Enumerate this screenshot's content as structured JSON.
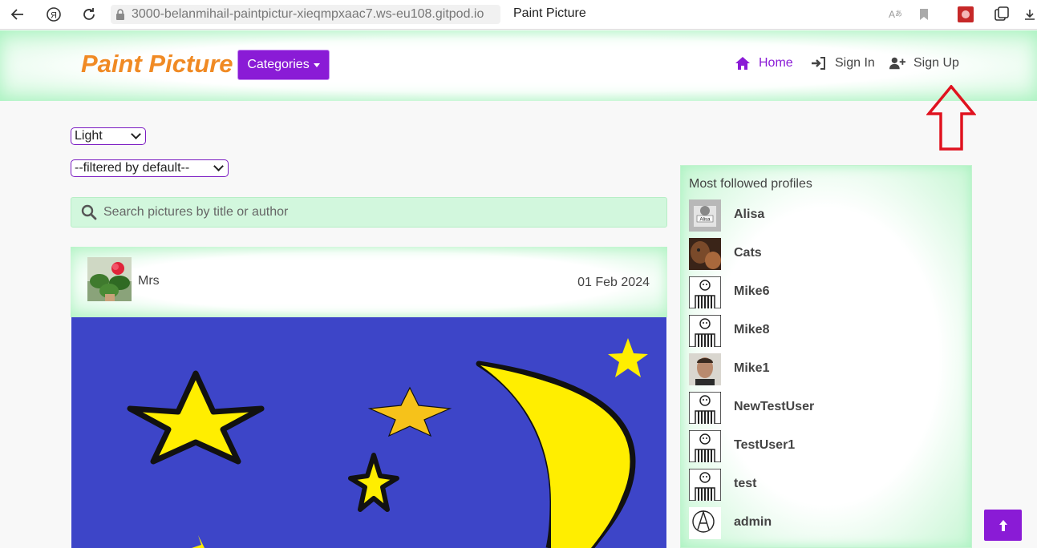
{
  "browser": {
    "url": "3000-belanmihail-paintpictur-xieqmpxaac7.ws-eu108.gitpod.io",
    "tab_title": "Paint Picture"
  },
  "header": {
    "brand": "Paint Picture",
    "categories_label": "Categories",
    "nav": [
      {
        "label": "Home",
        "icon": "home-icon"
      },
      {
        "label": "Sign In",
        "icon": "sign-in-icon"
      },
      {
        "label": "Sign Up",
        "icon": "user-plus-icon"
      }
    ]
  },
  "controls": {
    "theme_select": "Light",
    "filter_select": "--filtered by default--",
    "search_placeholder": "Search pictures by title or author"
  },
  "post": {
    "author": "Mrs",
    "date": "01 Feb 2024"
  },
  "sidebar": {
    "title": "Most followed profiles",
    "profiles": [
      {
        "name": "Alisa",
        "avatar_caption": "Alisa"
      },
      {
        "name": "Cats"
      },
      {
        "name": "Mike6"
      },
      {
        "name": "Mike8"
      },
      {
        "name": "Mike1"
      },
      {
        "name": "NewTestUser"
      },
      {
        "name": "TestUser1"
      },
      {
        "name": "test"
      },
      {
        "name": "admin"
      }
    ]
  },
  "colors": {
    "accent": "#8a1bd6",
    "brand": "#f08a24",
    "header_glow": "#c9f7d6",
    "annotation": "#e0121f",
    "painting_bg": "#3d45c8",
    "star_yellow": "#ffee00"
  }
}
